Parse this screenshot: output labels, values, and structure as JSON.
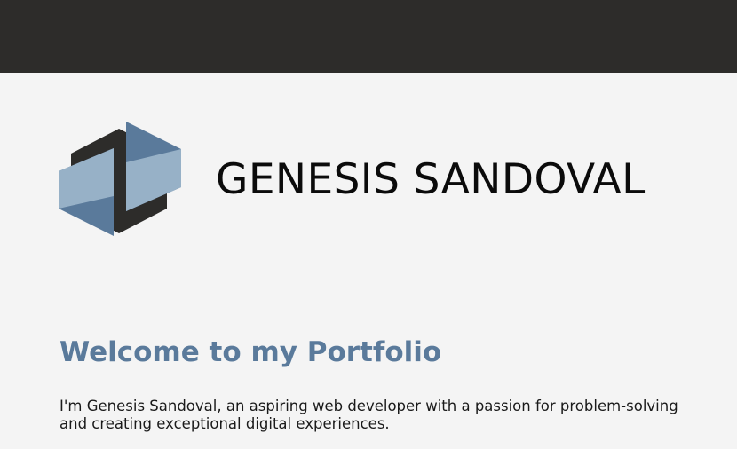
{
  "header": {
    "background_color": "#2d2c2a"
  },
  "logo": {
    "icon": "geometric-hexagon-logo-icon",
    "colors": {
      "dark": "#2d2c2a",
      "blue": "#5a7a9b",
      "light_blue": "#97b1c7"
    }
  },
  "hero": {
    "name": "GENESIS SANDOVAL"
  },
  "main": {
    "heading": "Welcome to my Portfolio",
    "intro_line1": "I'm Genesis Sandoval, an aspiring web developer with a passion for problem-solving",
    "intro_line2": "and creating exceptional digital experiences."
  },
  "colors": {
    "page_background": "#f4f4f4",
    "heading": "#5a7a9b",
    "text": "#1a1a1a"
  }
}
